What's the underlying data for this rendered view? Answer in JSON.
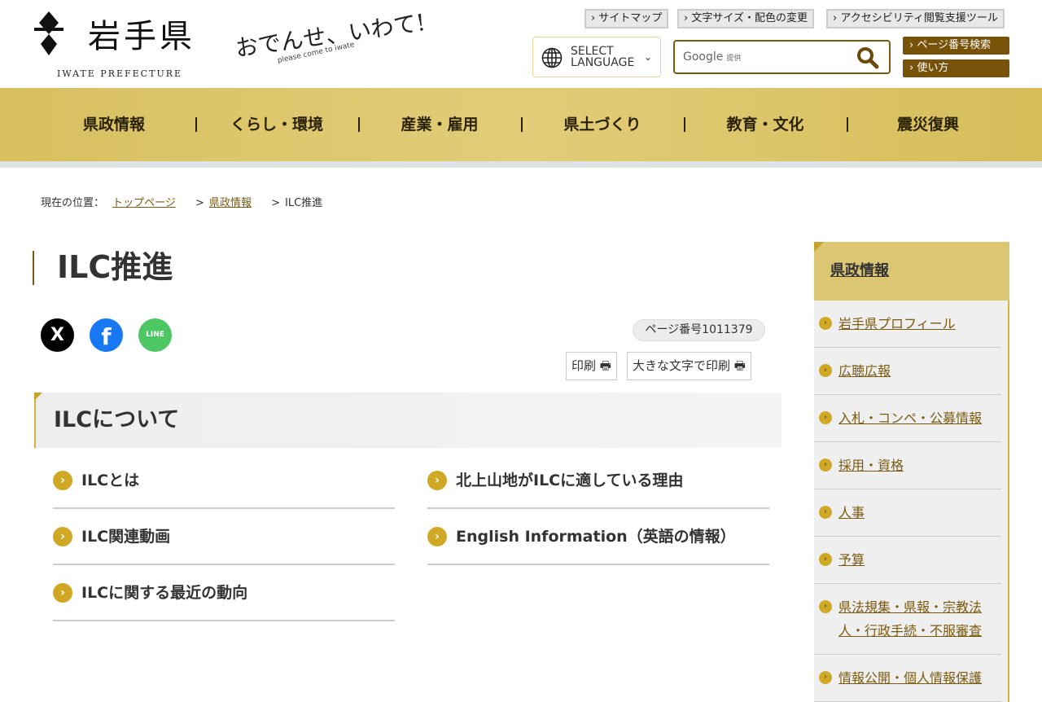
{
  "header": {
    "logo": "岩手県",
    "logo_sub": "IWATE PREFECTURE",
    "slogan": "おでんせ、いわて!",
    "slogan_sub": "please come to iwate",
    "top_links": [
      "サイトマップ",
      "文字サイズ・配色の変更",
      "アクセシビリティ閲覧支援ツール"
    ],
    "language": {
      "line1": "SELECT",
      "line2": "LANGUAGE"
    },
    "search": {
      "placeholder": "Google",
      "provided": "提供"
    },
    "page_search": "ページ番号検索",
    "howto": "使い方"
  },
  "nav": [
    "県政情報",
    "くらし・環境",
    "産業・雇用",
    "県土づくり",
    "教育・文化",
    "震災復興"
  ],
  "breadcrumb": {
    "label": "現在の位置：",
    "items": [
      "トップページ",
      "県政情報"
    ],
    "current": "ILC推進"
  },
  "main": {
    "title": "ILC推進",
    "sns": {
      "x": "X",
      "facebook": "f",
      "line": "LINE"
    },
    "page_number": "ページ番号1011379",
    "print": "印刷",
    "print_large": "大きな文字で印刷",
    "section_title": "ILCについて",
    "links": [
      "ILCとは",
      "北上山地がILCに適している理由",
      "ILC関連動画",
      "English Information（英語の情報）",
      "ILCに関する最近の動向"
    ]
  },
  "sidebar": {
    "title": "県政情報",
    "items": [
      "岩手県プロフィール",
      "広聴広報",
      "入札・コンペ・公募情報",
      "採用・資格",
      "人事",
      "予算",
      "県法規集・県報・宗教法人・行政手続・不服審査",
      "情報公開・個人情報保護"
    ]
  }
}
